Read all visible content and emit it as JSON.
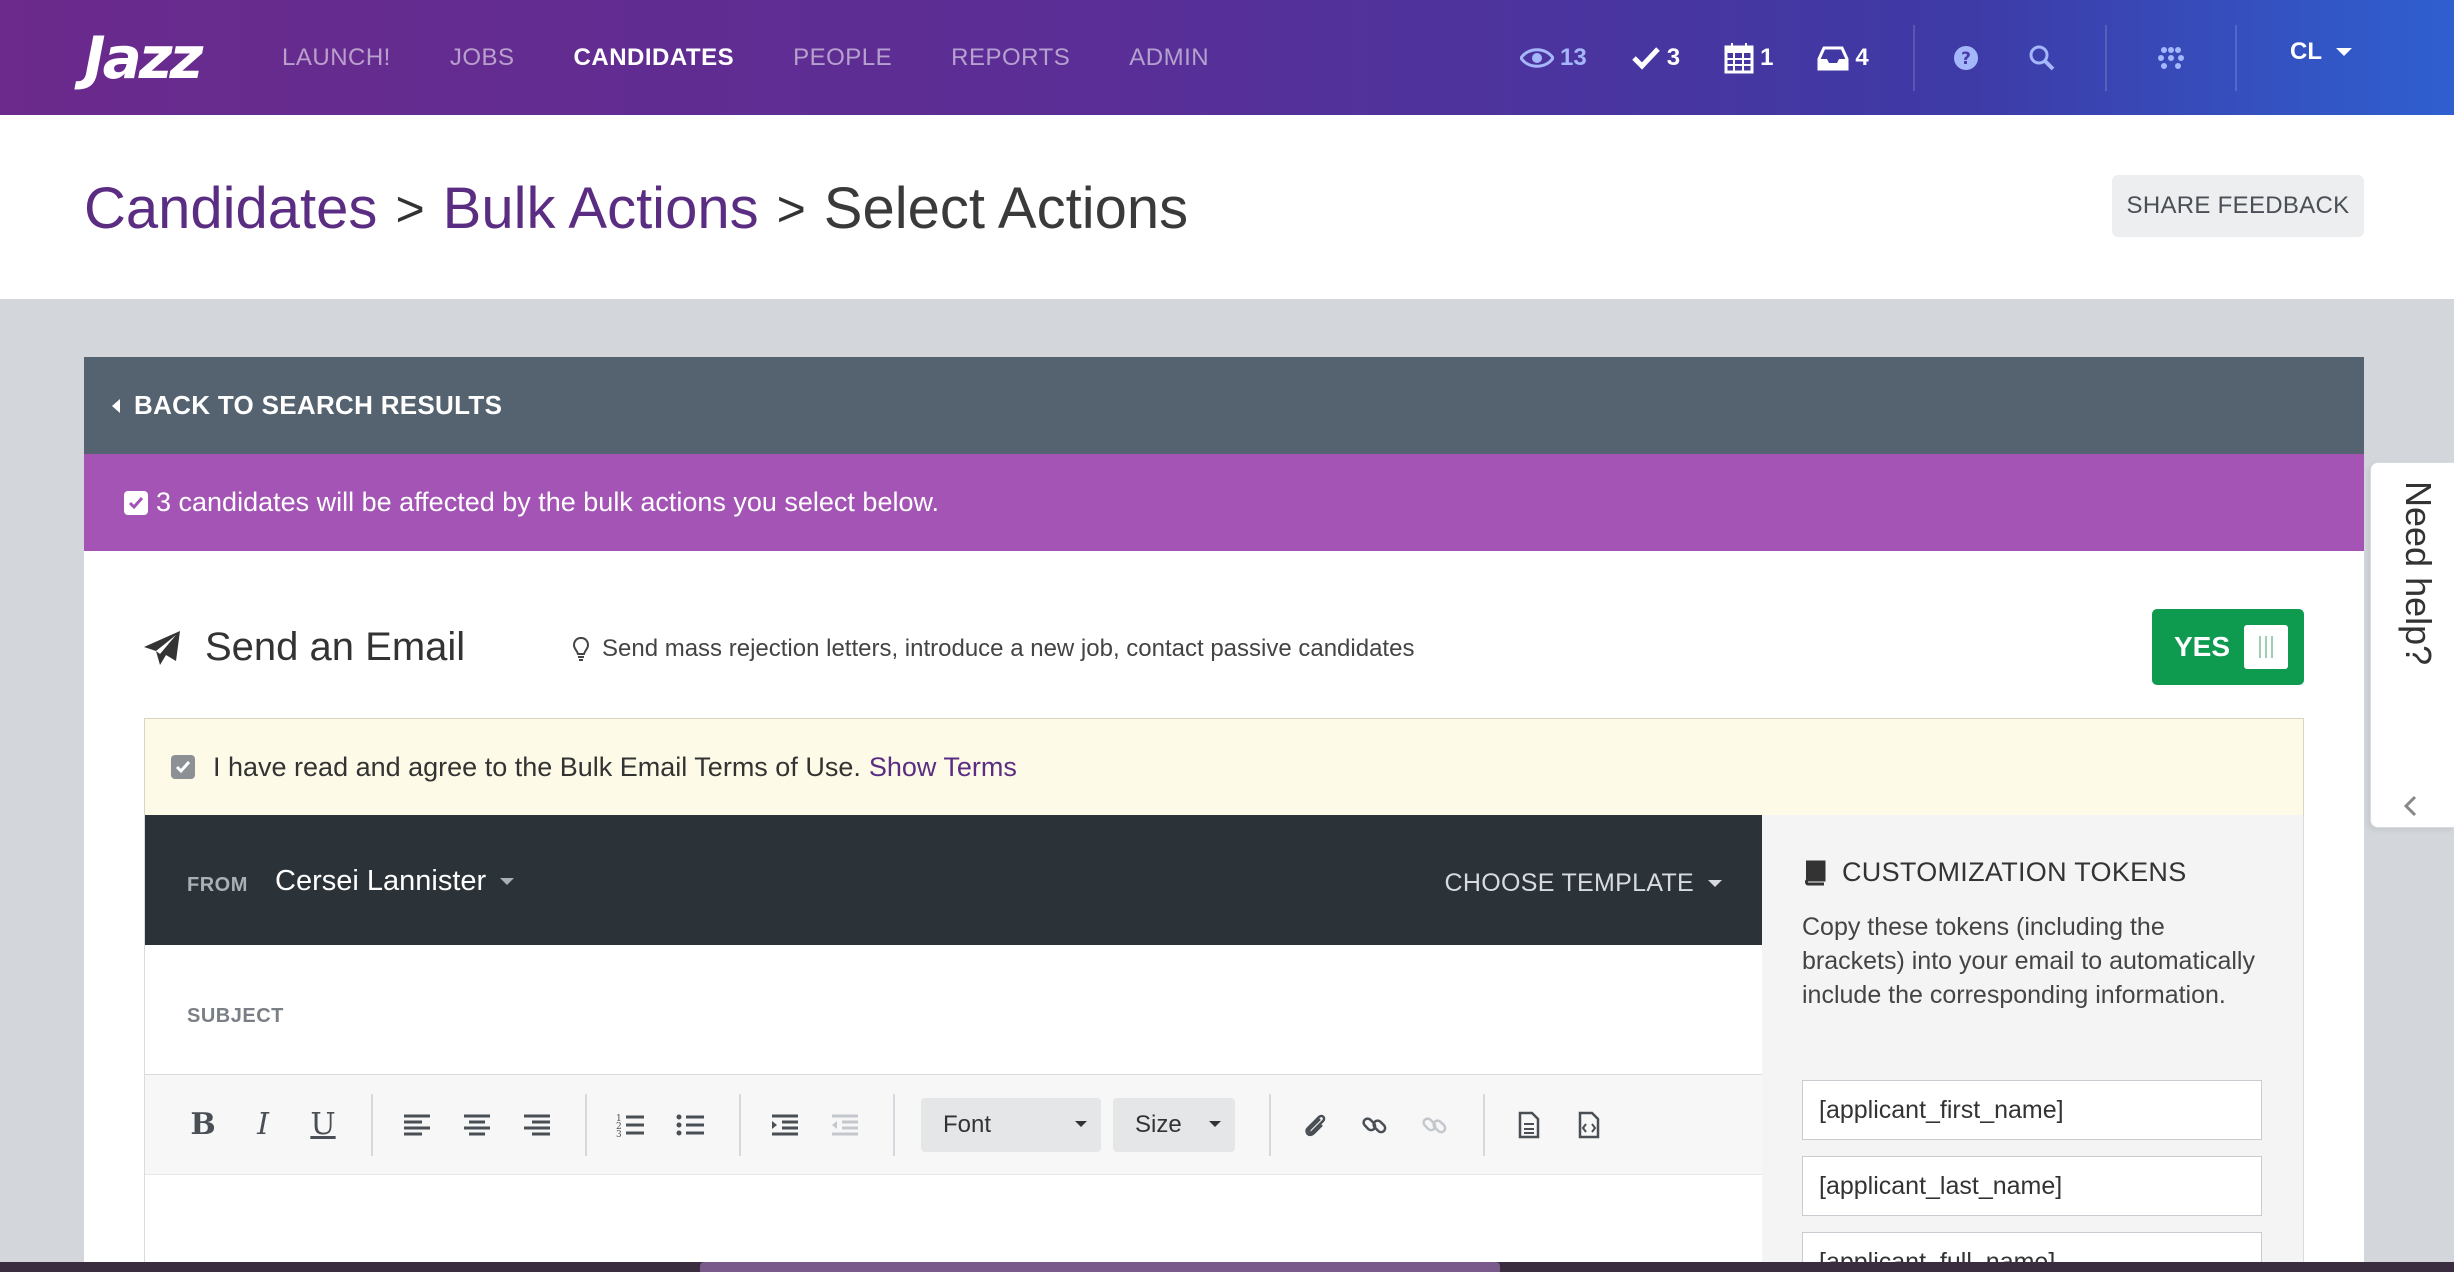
{
  "app": {
    "logo": "Jazz"
  },
  "nav": {
    "links": [
      "LAUNCH!",
      "JOBS",
      "CANDIDATES",
      "PEOPLE",
      "REPORTS",
      "ADMIN"
    ],
    "active": "CANDIDATES",
    "counters": {
      "views": "13",
      "tasks": "3",
      "calendar": "1",
      "inbox": "4"
    },
    "profile": "CL"
  },
  "header": {
    "breadcrumb": [
      "Candidates",
      "Bulk Actions",
      "Select Actions"
    ],
    "separator": ">",
    "share_feedback": "SHARE FEEDBACK"
  },
  "panel": {
    "back_label": "BACK TO SEARCH RESULTS",
    "notice": "3 candidates will be affected by the bulk actions you select below."
  },
  "email": {
    "title": "Send an Email",
    "hint": "Send mass rejection letters, introduce a new job, contact passive candidates",
    "toggle_label": "YES",
    "terms_text": "I have read and agree to the Bulk Email Terms of Use.",
    "terms_link": "Show Terms",
    "from_label": "FROM",
    "from_value": "Cersei Lannister",
    "choose_template": "CHOOSE TEMPLATE",
    "subject_label": "SUBJECT",
    "font_select": "Font",
    "size_select": "Size"
  },
  "tokens": {
    "title": "CUSTOMIZATION TOKENS",
    "description": "Copy these tokens (including the brackets) into your email to automatically include the corresponding information.",
    "items": [
      "[applicant_first_name]",
      "[applicant_last_name]",
      "[applicant_full_name]"
    ]
  },
  "help": {
    "label": "Need help?"
  },
  "colors": {
    "brand_purple": "#5b2d82",
    "notice_purple": "#a354b5",
    "toggle_green": "#0e9a4f",
    "back_bar": "#556270"
  }
}
